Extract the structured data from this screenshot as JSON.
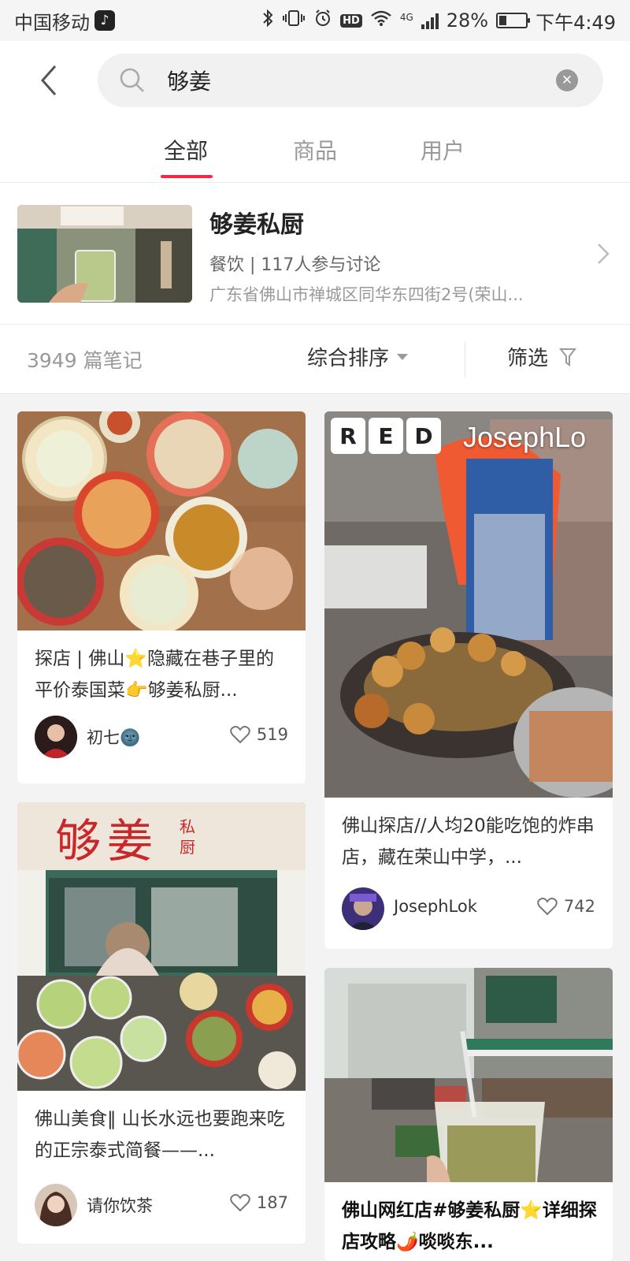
{
  "status_bar": {
    "carrier": "中国移动",
    "network": "4G",
    "battery": "28%",
    "battery_level": 0.28,
    "time": "下午4:49",
    "icons": [
      "tiktok-icon",
      "bluetooth-icon",
      "vibrate-icon",
      "alarm-icon",
      "hd-icon",
      "wifi-icon",
      "signal-icon",
      "battery-icon"
    ]
  },
  "search": {
    "query": "够姜",
    "hd_label": "HD"
  },
  "tabs": [
    {
      "label": "全部",
      "active": true
    },
    {
      "label": "商品",
      "active": false
    },
    {
      "label": "用户",
      "active": false
    }
  ],
  "poi": {
    "name": "够姜私厨",
    "meta": "餐饮 | 117人参与讨论",
    "address": "广东省佛山市禅城区同华东四街2号(荣山..."
  },
  "filter": {
    "count": "3949 篇笔记",
    "sort": "综合排序",
    "filter": "筛选"
  },
  "cards": [
    {
      "title": "探店 | 佛山⭐隐藏在巷子里的平价泰国菜👉够姜私厨...",
      "author": "初七🌚",
      "likes": "519"
    },
    {
      "title": "佛山探店//人均20能吃饱的炸串店，藏在荣山中学，...",
      "author": "JosephLok",
      "likes": "742",
      "watermark_letters": [
        "R",
        "E",
        "D"
      ],
      "watermark_name": "JosephLo"
    },
    {
      "title": "佛山美食‖ 山长水远也要跑来吃的正宗泰式简餐——...",
      "author": "请你饮茶",
      "likes": "187",
      "sign_text": "够姜",
      "sign_small": "私厨"
    },
    {
      "title": "佛山网红店#够姜私厨⭐详细探店攻略🌶️啖啖东..."
    }
  ],
  "colors": {
    "accent": "#ff2442",
    "background": "#f3f3f3"
  }
}
